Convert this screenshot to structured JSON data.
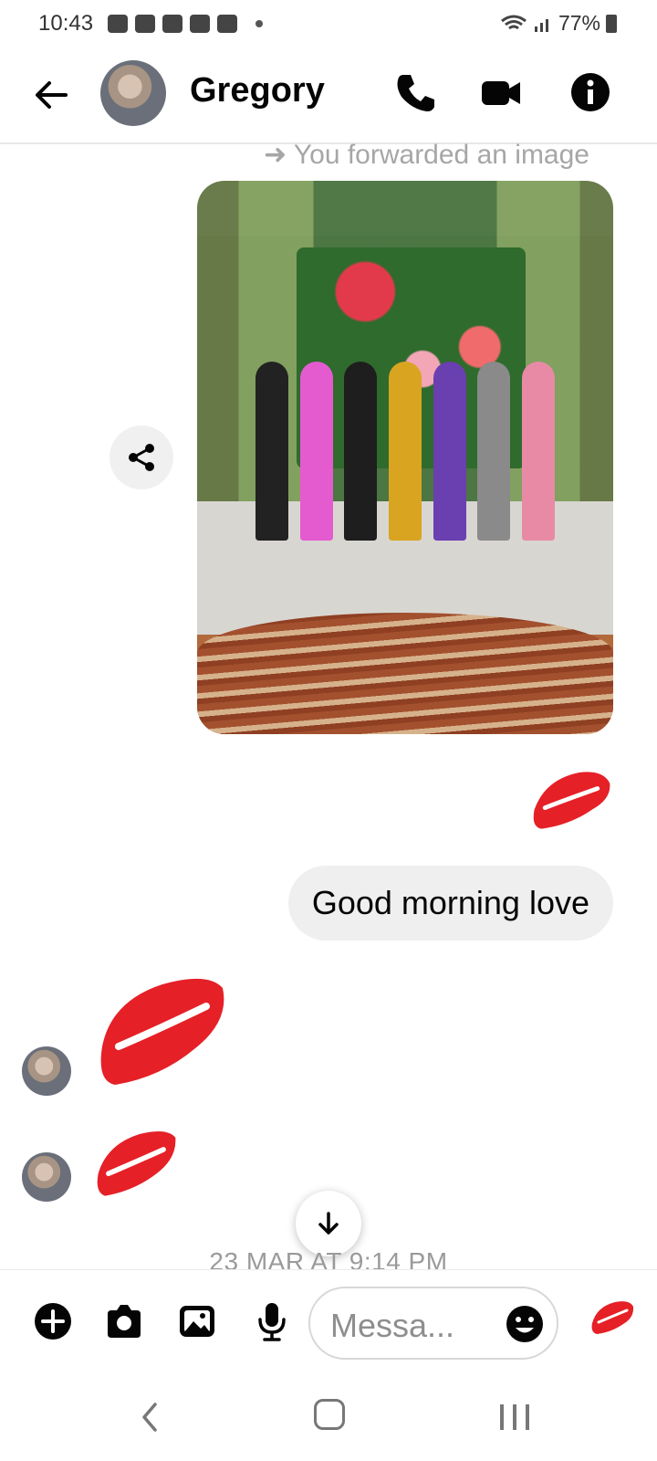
{
  "status_bar": {
    "time": "10:43",
    "battery": "77%"
  },
  "header": {
    "contact_name": "Gregory",
    "icons": [
      "back-arrow-icon",
      "phone-icon",
      "video-camera-icon",
      "info-icon"
    ]
  },
  "thread": {
    "forward_label": "You forwarded an image",
    "outgoing_text": "Good morning love",
    "timestamp": "23 MAR AT 9:14 PM"
  },
  "composer": {
    "placeholder": "Messa...",
    "icons": [
      "plus-icon",
      "camera-icon",
      "gallery-icon",
      "mic-icon",
      "emoji-icon",
      "kiss-icon"
    ]
  },
  "colors": {
    "kiss_red": "#e62027",
    "bubble_grey": "#efefef",
    "muted_text": "#a6a6a6"
  }
}
